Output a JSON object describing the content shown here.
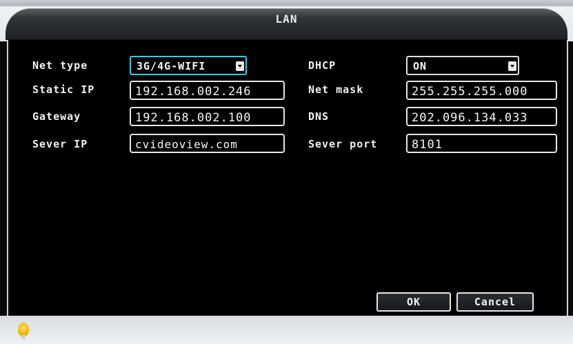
{
  "window": {
    "title": "LAN"
  },
  "form": {
    "net_type": {
      "label": "Net type",
      "value": "3G/4G-WIFI"
    },
    "static_ip": {
      "label": "Static IP",
      "value": "192.168.002.246"
    },
    "gateway": {
      "label": "Gateway",
      "value": "192.168.002.100"
    },
    "server_ip": {
      "label": "Sever IP",
      "value": "cvideoview.com"
    },
    "dhcp": {
      "label": "DHCP",
      "value": "ON"
    },
    "net_mask": {
      "label": "Net mask",
      "value": "255.255.255.000"
    },
    "dns": {
      "label": "DNS",
      "value": "202.096.134.033"
    },
    "server_port": {
      "label": "Sever port",
      "value": "8101"
    }
  },
  "buttons": {
    "ok": "OK",
    "cancel": "Cancel"
  },
  "colors": {
    "accent": "#3bc9e6",
    "panel_bg": "#000000",
    "frame": "#e6e9ee"
  },
  "icons": {
    "status": "lightbulb-icon",
    "dropdown": "dropdown-arrow-icon"
  }
}
